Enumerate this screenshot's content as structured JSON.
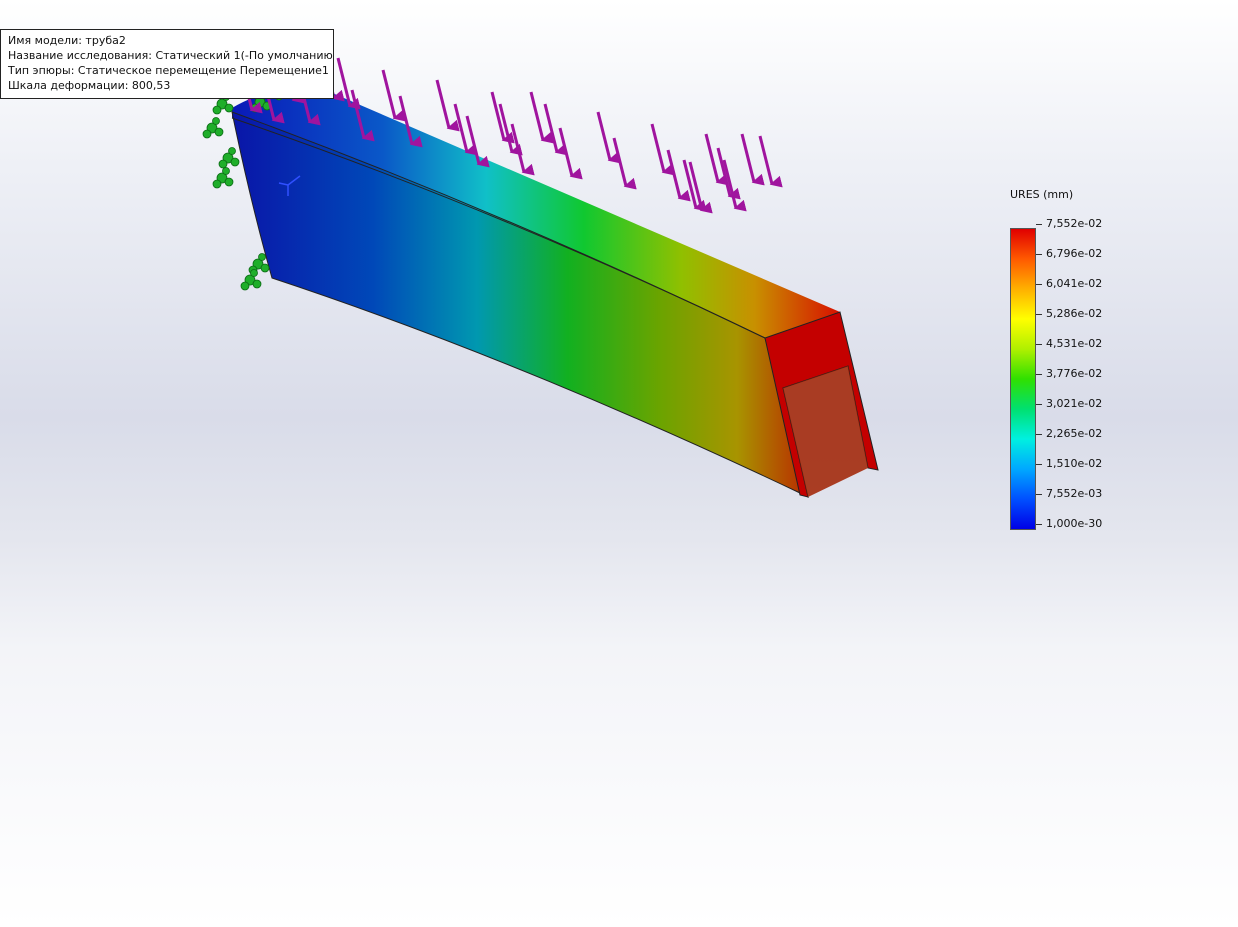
{
  "info": {
    "lines": [
      "Имя модели: труба2",
      "Название исследования: Статический 1(-По умолчанию-)",
      "Тип эпюры: Статическое перемещение Перемещение1",
      "Шкала деформации: 800,53"
    ]
  },
  "legend": {
    "title": "URES (mm)",
    "values": [
      "7,552e-02",
      "6,796e-02",
      "6,041e-02",
      "5,286e-02",
      "4,531e-02",
      "3,776e-02",
      "3,021e-02",
      "2,265e-02",
      "1,510e-02",
      "7,552e-03",
      "1,000e-30"
    ]
  },
  "colors": {
    "fixture": "#1fae2a",
    "load_arrow": "#a0149e",
    "max": "#cc0000",
    "min": "#0a14a8"
  },
  "icons": {
    "fixture": "fixture-icon",
    "load": "load-arrow-icon",
    "axis": "axis-triad-icon"
  }
}
